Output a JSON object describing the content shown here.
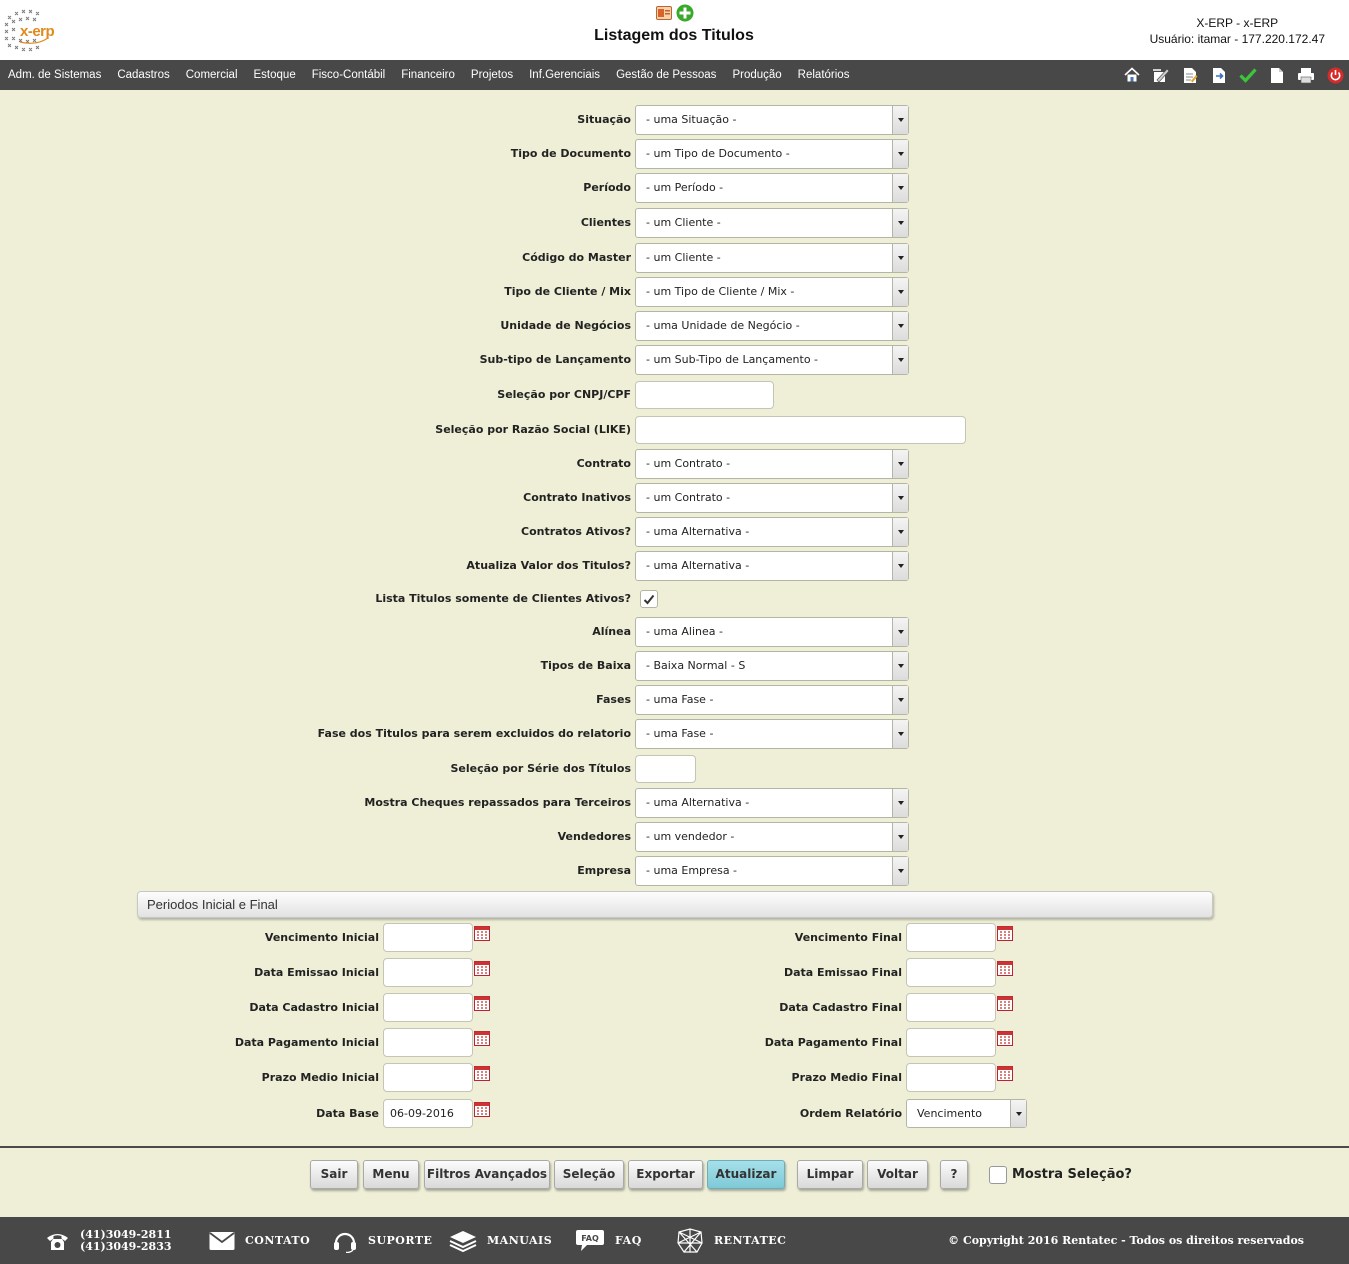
{
  "header": {
    "page_title": "Listagem dos Titulos",
    "system": "X-ERP - x-ERP",
    "user": "Usuário: itamar - 177.220.172.47",
    "logo_text": "x-erp"
  },
  "menu": {
    "items": [
      "Adm. de Sistemas",
      "Cadastros",
      "Comercial",
      "Estoque",
      "Fisco-Contábil",
      "Financeiro",
      "Projetos",
      "Inf.Gerenciais",
      "Gestão de Pessoas",
      "Produção",
      "Relatórios"
    ],
    "tools": [
      "home-icon",
      "edit-icon",
      "document-edit-icon",
      "export-icon",
      "check-icon",
      "new-document-icon",
      "print-icon",
      "power-icon"
    ]
  },
  "form": {
    "situacao": {
      "label": "Situação",
      "value": "- uma Situação -"
    },
    "tipo_documento": {
      "label": "Tipo de Documento",
      "value": "- um Tipo de Documento -"
    },
    "periodo": {
      "label": "Período",
      "value": "- um Período -"
    },
    "clientes": {
      "label": "Clientes",
      "value": "- um Cliente -"
    },
    "codigo_master": {
      "label": "Código do Master",
      "value": "- um Cliente -"
    },
    "tipo_cliente": {
      "label": "Tipo de Cliente / Mix",
      "value": "- um Tipo de Cliente / Mix -"
    },
    "unidade_negocios": {
      "label": "Unidade de Negócios",
      "value": "- uma Unidade de Negócio -"
    },
    "subtipo_lancamento": {
      "label": "Sub-tipo de Lançamento",
      "value": "- um Sub-Tipo de Lançamento -"
    },
    "cnpj": {
      "label": "Seleção por CNPJ/CPF",
      "value": ""
    },
    "razao_social": {
      "label": "Seleção por Razão Social (LIKE)",
      "value": ""
    },
    "contrato": {
      "label": "Contrato",
      "value": "- um Contrato -"
    },
    "contrato_inativos": {
      "label": "Contrato Inativos",
      "value": "- um Contrato -"
    },
    "contratos_ativos": {
      "label": "Contratos Ativos?",
      "value": "- uma Alternativa -"
    },
    "atualiza_valor": {
      "label": "Atualiza Valor dos Titulos?",
      "value": "- uma Alternativa -"
    },
    "lista_titulos": {
      "label": "Lista Titulos somente de Clientes Ativos?",
      "checked": true
    },
    "alinea": {
      "label": "Alínea",
      "value": "- uma Alinea -"
    },
    "tipos_baixa": {
      "label": "Tipos de Baixa",
      "value": "- Baixa Normal - S"
    },
    "fases": {
      "label": "Fases",
      "value": "- uma Fase -"
    },
    "fase_excluidos": {
      "label": "Fase dos Titulos para serem excluidos do relatorio",
      "value": "- uma Fase -"
    },
    "serie_titulos": {
      "label": "Seleção por Série dos Títulos",
      "value": ""
    },
    "mostra_cheques": {
      "label": "Mostra Cheques repassados para Terceiros",
      "value": "- uma Alternativa -"
    },
    "vendedores": {
      "label": "Vendedores",
      "value": "- um vendedor -"
    },
    "empresa": {
      "label": "Empresa",
      "value": "- uma Empresa -"
    }
  },
  "periodos": {
    "title": "Periodos Inicial e Final",
    "vencimento_inicial": {
      "label": "Vencimento Inicial",
      "value": ""
    },
    "vencimento_final": {
      "label": "Vencimento Final",
      "value": ""
    },
    "emissao_inicial": {
      "label": "Data Emissao Inicial",
      "value": ""
    },
    "emissao_final": {
      "label": "Data Emissao Final",
      "value": ""
    },
    "cadastro_inicial": {
      "label": "Data Cadastro Inicial",
      "value": ""
    },
    "cadastro_final": {
      "label": "Data Cadastro Final",
      "value": ""
    },
    "pagamento_inicial": {
      "label": "Data Pagamento Inicial",
      "value": ""
    },
    "pagamento_final": {
      "label": "Data Pagamento Final",
      "value": ""
    },
    "prazo_inicial": {
      "label": "Prazo Medio Inicial",
      "value": ""
    },
    "prazo_final": {
      "label": "Prazo Medio Final",
      "value": ""
    },
    "data_base": {
      "label": "Data Base",
      "value": "06-09-2016"
    },
    "ordem_relatorio": {
      "label": "Ordem Relatório",
      "value": "Vencimento"
    }
  },
  "buttons": {
    "sair": "Sair",
    "menu": "Menu",
    "filtros": "Filtros Avançados",
    "selecao": "Seleção",
    "exportar": "Exportar",
    "atualizar": "Atualizar",
    "limpar": "Limpar",
    "voltar": "Voltar",
    "help": "?",
    "mostra_selecao": "Mostra Seleção?"
  },
  "footer": {
    "phone1": "(41)3049-2811",
    "phone2": "(41)3049-2833",
    "contato": "CONTATO",
    "suporte": "SUPORTE",
    "manuais": "MANUAIS",
    "faq": "FAQ",
    "faq_icon_text": "FAQ",
    "rentatec": "RENTATEC",
    "copyright": "© Copyright 2016 Rentatec - Todos os direitos reservados"
  },
  "colors": {
    "background": "#efefd7",
    "bar": "#484848",
    "primary_button": "#8fd3de"
  }
}
